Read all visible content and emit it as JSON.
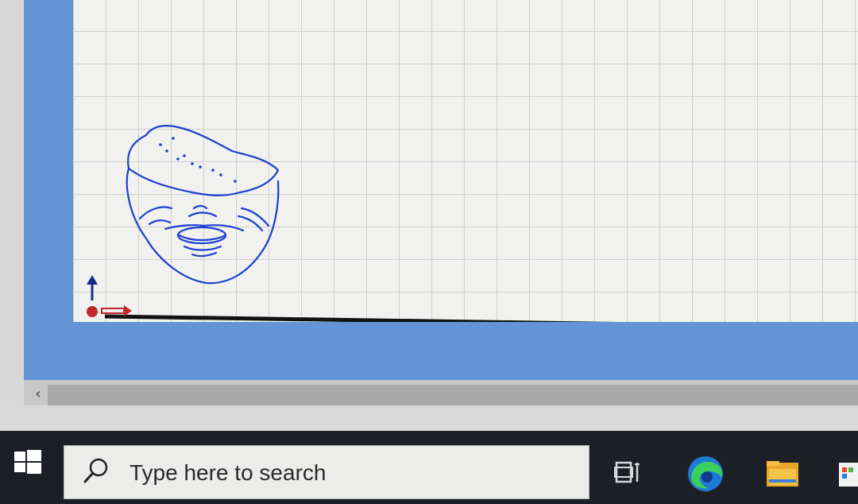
{
  "app": {
    "canvas": {
      "sketch": "blue-line-face-drawing",
      "origin_marker": "origin-triad"
    },
    "scrollbar": {
      "left_arrow": "‹"
    }
  },
  "taskbar": {
    "start_icon": "windows-logo-icon",
    "search": {
      "placeholder": "Type here to search",
      "icon": "search-icon"
    },
    "pinned": [
      {
        "name": "task-view-icon"
      },
      {
        "name": "edge-browser-icon"
      },
      {
        "name": "file-explorer-icon"
      },
      {
        "name": "store-icon"
      }
    ]
  },
  "colors": {
    "workspace_bg": "#6493d6",
    "grid_bg": "#f1f1ef",
    "grid_line": "#cfcfcf",
    "sketch_stroke": "#1c3fcf",
    "taskbar_bg": "#1c2026",
    "axis_x": "#c0282d",
    "axis_y": "#1b2b8a"
  }
}
